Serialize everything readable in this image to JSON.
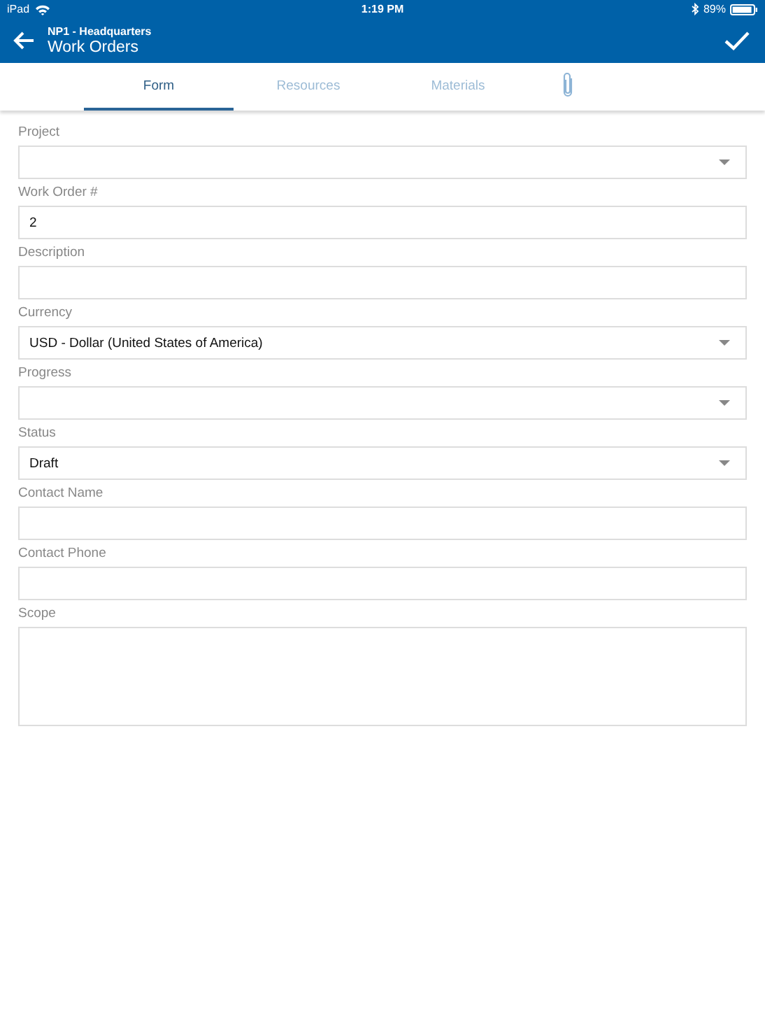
{
  "status_bar": {
    "carrier": "iPad",
    "time": "1:19 PM",
    "battery": "89%"
  },
  "header": {
    "subtitle": "NP1 - Headquarters",
    "title": "Work Orders"
  },
  "tabs": [
    {
      "kind": "text",
      "label": "Form",
      "selected": true
    },
    {
      "kind": "text",
      "label": "Resources",
      "selected": false
    },
    {
      "kind": "text",
      "label": "Materials",
      "selected": false
    },
    {
      "kind": "attachment",
      "selected": false
    }
  ],
  "fields": [
    {
      "kind": "select",
      "label": "Project"
    },
    {
      "kind": "text",
      "label": "Work Order #",
      "value": "2"
    },
    {
      "kind": "text",
      "label": "Description"
    },
    {
      "kind": "select",
      "label": "Currency",
      "value": "USD - Dollar (United States of America)"
    },
    {
      "kind": "select",
      "label": "Progress"
    },
    {
      "kind": "select",
      "label": "Status",
      "value": "Draft"
    },
    {
      "kind": "text",
      "label": "Contact Name"
    },
    {
      "kind": "text",
      "label": "Contact Phone"
    },
    {
      "kind": "textarea",
      "label": "Scope"
    }
  ]
}
